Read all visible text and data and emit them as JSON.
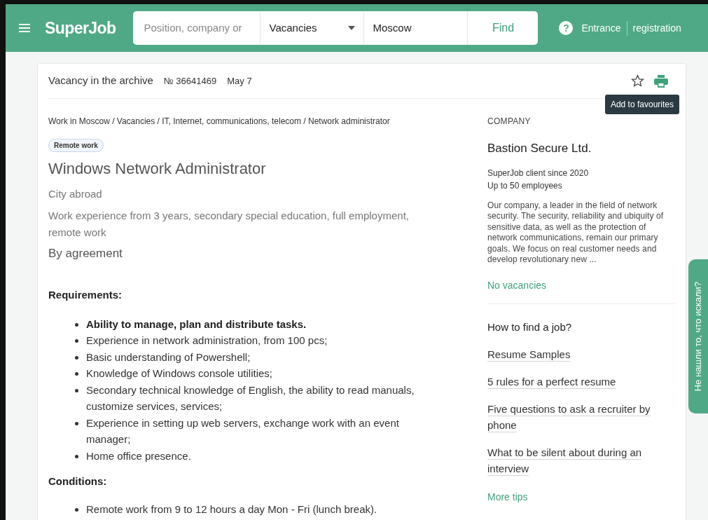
{
  "header": {
    "logo": "SuperJob",
    "search": {
      "placeholder": "Position, company or"
    },
    "category": "Vacancies",
    "city": "Moscow",
    "find_button": "Find",
    "help": "?",
    "login": "Entrance",
    "register": "registration"
  },
  "vacancy_bar": {
    "status": "Vacancy in the archive",
    "number": "№ 36641469",
    "date": "May 7",
    "tooltip": "Add to favourites",
    "favourite": false
  },
  "breadcrumbs": "Work in Moscow / Vacancies / IT, Internet, communications, telecom / Network administrator",
  "tag": "Remote work",
  "title": "Windows Network Administrator",
  "location": "City abroad",
  "details": "Work experience from 3 years, secondary special education, full employment, remote work",
  "salary": "By agreement",
  "sections": [
    {
      "heading": "Requirements:",
      "items": [
        {
          "text": "Ability to manage, plan and distribute tasks.",
          "bold": true
        },
        {
          "text": "Experience in network administration, from 100 pcs;",
          "bold": false
        },
        {
          "text": "Basic understanding of Powershell;",
          "bold": false
        },
        {
          "text": "Knowledge of Windows console utilities;",
          "bold": false
        },
        {
          "text": "Secondary technical knowledge of English, the ability to read manuals, customize services, services;",
          "bold": false
        },
        {
          "text": "Experience in setting up web servers, exchange work with an event manager;",
          "bold": false
        },
        {
          "text": "Home office presence.",
          "bold": false
        }
      ]
    },
    {
      "heading": "Conditions:",
      "items": [
        {
          "text": "Remote work from 9 to 12 hours a day Mon - Fri (lunch break).",
          "bold": false
        }
      ]
    }
  ],
  "company": {
    "label": "COMPANY",
    "name": "Bastion Secure Ltd.",
    "since": "SuperJob client since 2020",
    "size": "Up to 50 employees",
    "description": "Our company, a leader in the field of network security. The security, reliability and ubiquity of sensitive data, as well as the protection of network communications, remain our primary goals. We focus on real customer needs and develop revolutionary new ...",
    "vacancies_link": "No vacancies"
  },
  "tips": {
    "heading": "How to find a job?",
    "links": [
      "Resume Samples",
      "5 rules for a perfect resume",
      "Five questions to ask a recruiter by phone",
      "What to be silent about during an interview"
    ],
    "more": "More tips"
  },
  "feedback_tab": "Не нашли то, что искали?"
}
